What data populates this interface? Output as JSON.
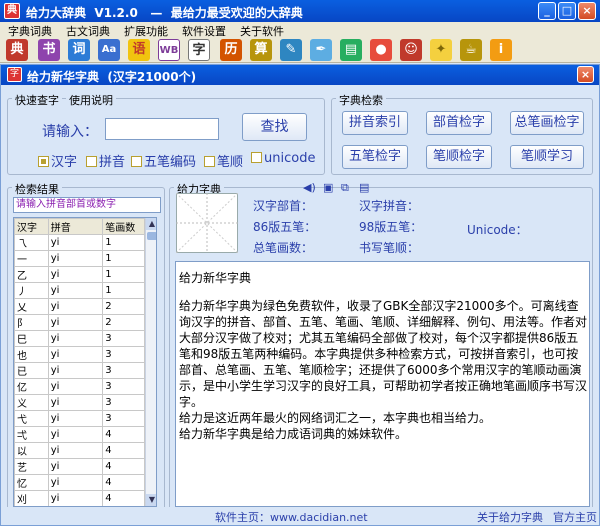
{
  "app": {
    "title": "给力大辞典  V1.2.0   —  最给力最受欢迎的大辞典",
    "icon_label": "典"
  },
  "menu": [
    "字典词典",
    "古文词典",
    "扩展功能",
    "软件设置",
    "关于软件"
  ],
  "toolbar_icons": [
    "dictionary-icon",
    "book-icon",
    "words-icon",
    "font-icon",
    "idiom-icon",
    "wb-icon",
    "char-icon",
    "calendar-icon",
    "abacus-icon",
    "memo-icon",
    "pen-icon",
    "chart-icon",
    "note-icon",
    "ball-icon",
    "figure-icon",
    "bulb-icon",
    "cup-icon",
    "info-icon"
  ],
  "inner": {
    "title": "给力新华字典  (汉字21000个)",
    "icon_label": "字"
  },
  "quick": {
    "tab1": "快速查字",
    "tab2": "使用说明",
    "input_label": "请输入：",
    "input_value": "",
    "search_label": "查找",
    "checks": [
      {
        "label": "汉字",
        "checked": true
      },
      {
        "label": "拼音",
        "checked": false
      },
      {
        "label": "五笔编码",
        "checked": false
      },
      {
        "label": "笔顺",
        "checked": false
      },
      {
        "label": "unicode",
        "checked": false
      }
    ]
  },
  "dict_search": {
    "title": "字典检索",
    "buttons": [
      "拼音索引",
      "部首检字",
      "总笔画检字",
      "五笔检字",
      "笔顺检字",
      "笔顺学习"
    ]
  },
  "results": {
    "title": "检索结果",
    "hint": "请输入拼音部首或数字",
    "headers": [
      "汉字",
      "拼音",
      "笔画数"
    ],
    "rows": [
      [
        "乁",
        "yi",
        "1"
      ],
      [
        "一",
        "yi",
        "1"
      ],
      [
        "乙",
        "yi",
        "1"
      ],
      [
        "丿",
        "yi",
        "1"
      ],
      [
        "乂",
        "yi",
        "2"
      ],
      [
        "阝",
        "yi",
        "2"
      ],
      [
        "巳",
        "yi",
        "3"
      ],
      [
        "也",
        "yi",
        "3"
      ],
      [
        "已",
        "yi",
        "3"
      ],
      [
        "亿",
        "yi",
        "3"
      ],
      [
        "义",
        "yi",
        "3"
      ],
      [
        "弋",
        "yi",
        "3"
      ],
      [
        "弌",
        "yi",
        "4"
      ],
      [
        "以",
        "yi",
        "4"
      ],
      [
        "艺",
        "yi",
        "4"
      ],
      [
        "忆",
        "yi",
        "4"
      ],
      [
        "刈",
        "yi",
        "4"
      ],
      [
        "辷",
        "yi",
        "4"
      ],
      [
        "鼡",
        "yi",
        "5"
      ]
    ]
  },
  "detail": {
    "title": "给力字典",
    "radical_label": "汉字部首：",
    "pinyin_label": "汉字拼音：",
    "wb86_label": "86版五笔：",
    "wb98_label": "98版五笔：",
    "unicode_label": "Unicode：",
    "strokes_label": "总笔画数：",
    "order_label": "书写笔顺：",
    "text_title": "给力新华字典",
    "text_p1": "给力新华字典为绿色免费软件，收录了GBK全部汉字21000多个。可离线查询汉字的拼音、部首、五笔、笔画、笔顺、详细解释、例句、用法等。作者对大部分汉字做了校对；尤其五笔编码全部做了校对，每个汉字都提供86版五笔和98版五笔两种编码。本字典提供多种检索方式，可按拼音索引，也可按部首、总笔画、五笔、笔顺检字；还提供了6000多个常用汉字的笔顺动画演示，是中小学生学习汉字的良好工具，可帮助初学者按正确地笔画顺序书写汉字。",
    "text_p2": "给力是这近两年最火的网络词汇之一，本字典也相当给力。",
    "text_p3": "给力新华字典是给力成语词典的姊妹软件。"
  },
  "status": {
    "homepage": "软件主页：www.dacidian.net",
    "about": "关于给力字典",
    "official": "官方主页"
  },
  "colors": {
    "titlebar": "#0a5fe0",
    "accent_text": "#2a3faa",
    "background": "#d9e6f7"
  }
}
